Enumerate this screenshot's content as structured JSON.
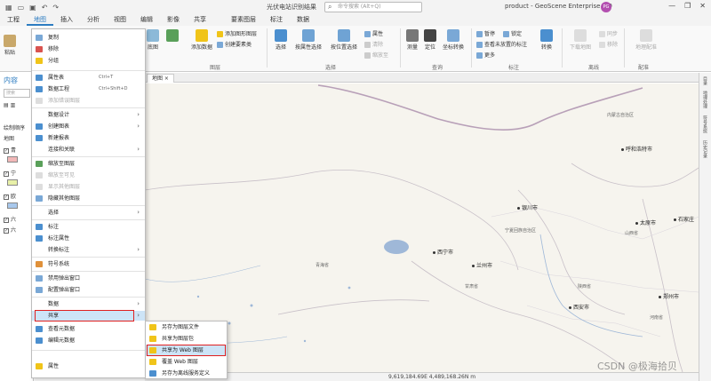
{
  "titlebar": {
    "doc_title": "光伏电站识别结果",
    "search_placeholder": "命令搜索 (Alt+Q)",
    "app_name": "product - GeoScene Enterprise 4.0",
    "avatar_initials": "PG",
    "undo_glyph": "↶",
    "redo_glyph": "↷",
    "minimize": "—",
    "restore": "❐",
    "close": "✕"
  },
  "tabs": [
    "工程",
    "地图",
    "插入",
    "分析",
    "视图",
    "编辑",
    "影像",
    "共享",
    "要素图层",
    "标注",
    "数据"
  ],
  "ribbon": {
    "paste": "粘贴",
    "basemap": "底图",
    "add_data": "添加数据",
    "add_graphics_layer": "添加图形图层",
    "create_feature_class": "创建要素类",
    "layer_group": "图层",
    "select": "选择",
    "select_by_attr": "按属性选择",
    "select_by_loc": "按位置选择",
    "attributes": "属性",
    "clear": "清除",
    "zoom_to": "缩放至",
    "selection_group": "选择",
    "measure": "测量",
    "locate": "定位",
    "coord_convert": "坐标转换",
    "query_group": "查询",
    "pause": "暂停",
    "lock": "锁定",
    "view_unplaced": "查看未放置的标注",
    "more": "更多",
    "convert": "转换",
    "label_group": "标注",
    "download_map": "下载地图",
    "sync": "同步",
    "remove": "移除",
    "offline_group": "离线",
    "geoprocess": "地理配准",
    "georef_group": "配准"
  },
  "pane": {
    "title": "内容",
    "search_placeholder": "搜索",
    "drawing_order": "绘制顺序",
    "map_item": "地图",
    "row_a": "青",
    "row_b": "宁",
    "row_c": "欧",
    "row_d": "六",
    "row_e": "六"
  },
  "map_tab": "地图",
  "context_menu": {
    "copy": "复制",
    "remove": "移除",
    "group": "分组",
    "attr_table": "属性表",
    "attr_shortcut": "Ctrl+T",
    "data_engineering": "数据工程",
    "data_eng_shortcut": "Ctrl+Shift+D",
    "add_error_layer": "添加错误图层",
    "data_design": "数据设计",
    "create_chart": "创建图表",
    "new_report": "新建报表",
    "joins_relates": "连接和关联",
    "zoom_to_layer": "缩放至图层",
    "zoom_to_visible": "缩放至可见",
    "show_other_layers": "显示其他图层",
    "hide_other_layers": "隐藏其他图层",
    "selection": "选择",
    "label": "标注",
    "label_properties": "标注属性",
    "convert_labels": "转换标注",
    "symbology": "符号系统",
    "disable_popups": "禁用弹出窗口",
    "configure_popups": "配置弹出窗口",
    "data": "数据",
    "share": "共享",
    "view_metadata": "查看元数据",
    "edit_metadata": "编辑元数据",
    "properties": "属性"
  },
  "share_submenu": {
    "save_layer_file": "另存为图层文件",
    "share_layer_package": "共享为图层包",
    "share_web_layer": "共享为 Web 图层",
    "overwrite_web_layer": "覆盖 Web 图层",
    "save_offline_service": "另存为离线服务定义"
  },
  "map_labels": {
    "hohhot": "呼和浩特市",
    "yinchuan": "银川市",
    "xining": "西宁市",
    "lanzhou": "兰州市",
    "xian": "西安市",
    "taiyuan": "太原市",
    "shijiazhuang": "石家庄",
    "zhengzhou": "郑州市",
    "inner_mongolia": "内蒙古自治区",
    "ningxia": "宁夏回族自治区",
    "qinghai": "青海省",
    "gansu": "甘肃省",
    "shaanxi": "陕西省",
    "shanxi": "山西省",
    "henan": "河南省"
  },
  "status": {
    "coords": "9,619,184.69E 4,489,168.26N m"
  },
  "right_dock": [
    "目录",
    "地理处理",
    "符号系统",
    "历史记录"
  ],
  "watermark": "CSDN @极海拾贝",
  "colors": {
    "accent": "#2d7cc1",
    "highlight": "#cde4f7",
    "red_box": "#e02020"
  }
}
